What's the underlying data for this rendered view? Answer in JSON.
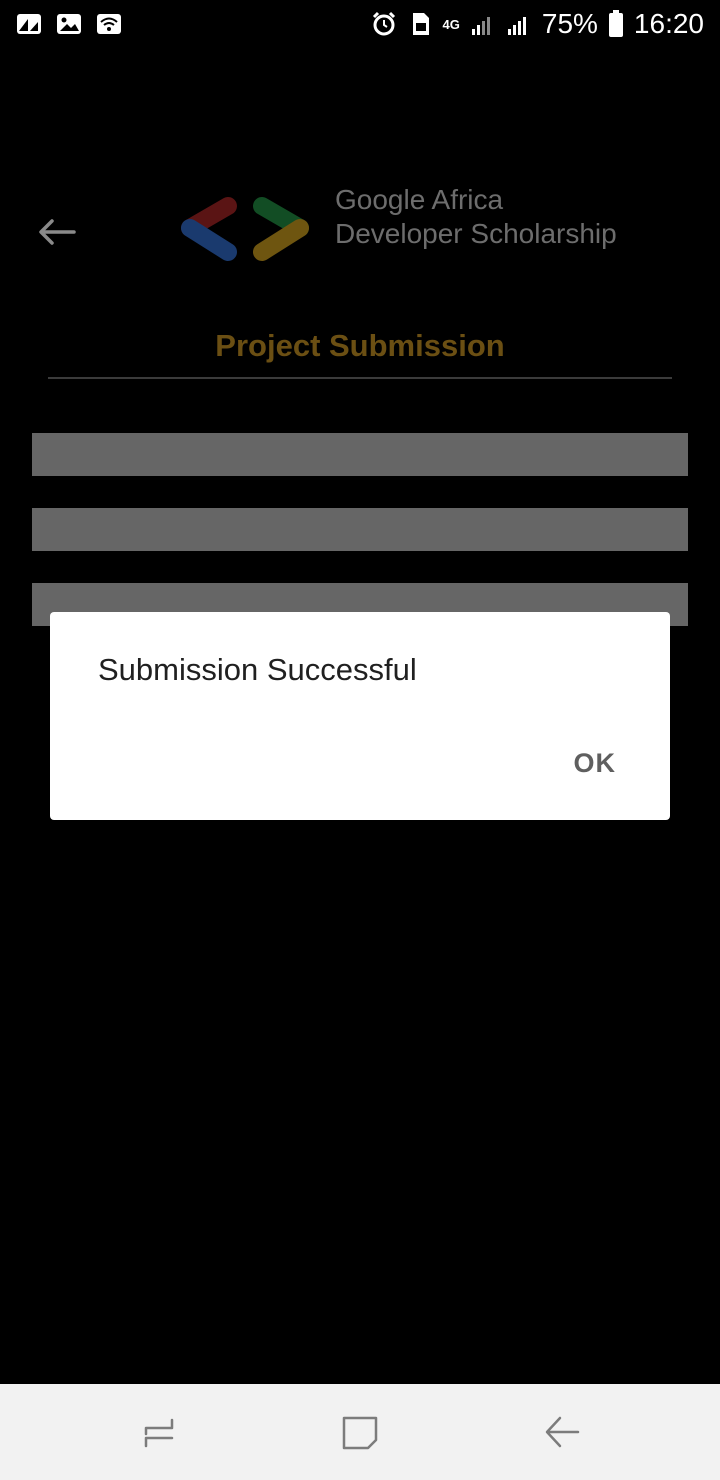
{
  "status_bar": {
    "battery_percent": "75%",
    "time": "16:20",
    "network_type": "4G",
    "icons": [
      "photo-notification-icon",
      "gallery-notification-icon",
      "wifi-icon",
      "alarm-icon",
      "sim-icon",
      "signal-icon",
      "signal-icon",
      "battery-icon"
    ]
  },
  "header": {
    "back_icon": "arrow-left-icon",
    "logo_line1": "Google Africa",
    "logo_line2": "Developer Scholarship",
    "logo_colors": [
      "#c62828",
      "#1e5bbf",
      "#1b7a3a",
      "#c79a16"
    ]
  },
  "page": {
    "title": "Project Submission",
    "title_color": "#6b4f13"
  },
  "dialog": {
    "message": "Submission Successful",
    "ok_label": "OK"
  },
  "nav_bar": {
    "recents_icon": "recents-icon",
    "home_icon": "home-icon",
    "back_icon": "back-icon"
  }
}
